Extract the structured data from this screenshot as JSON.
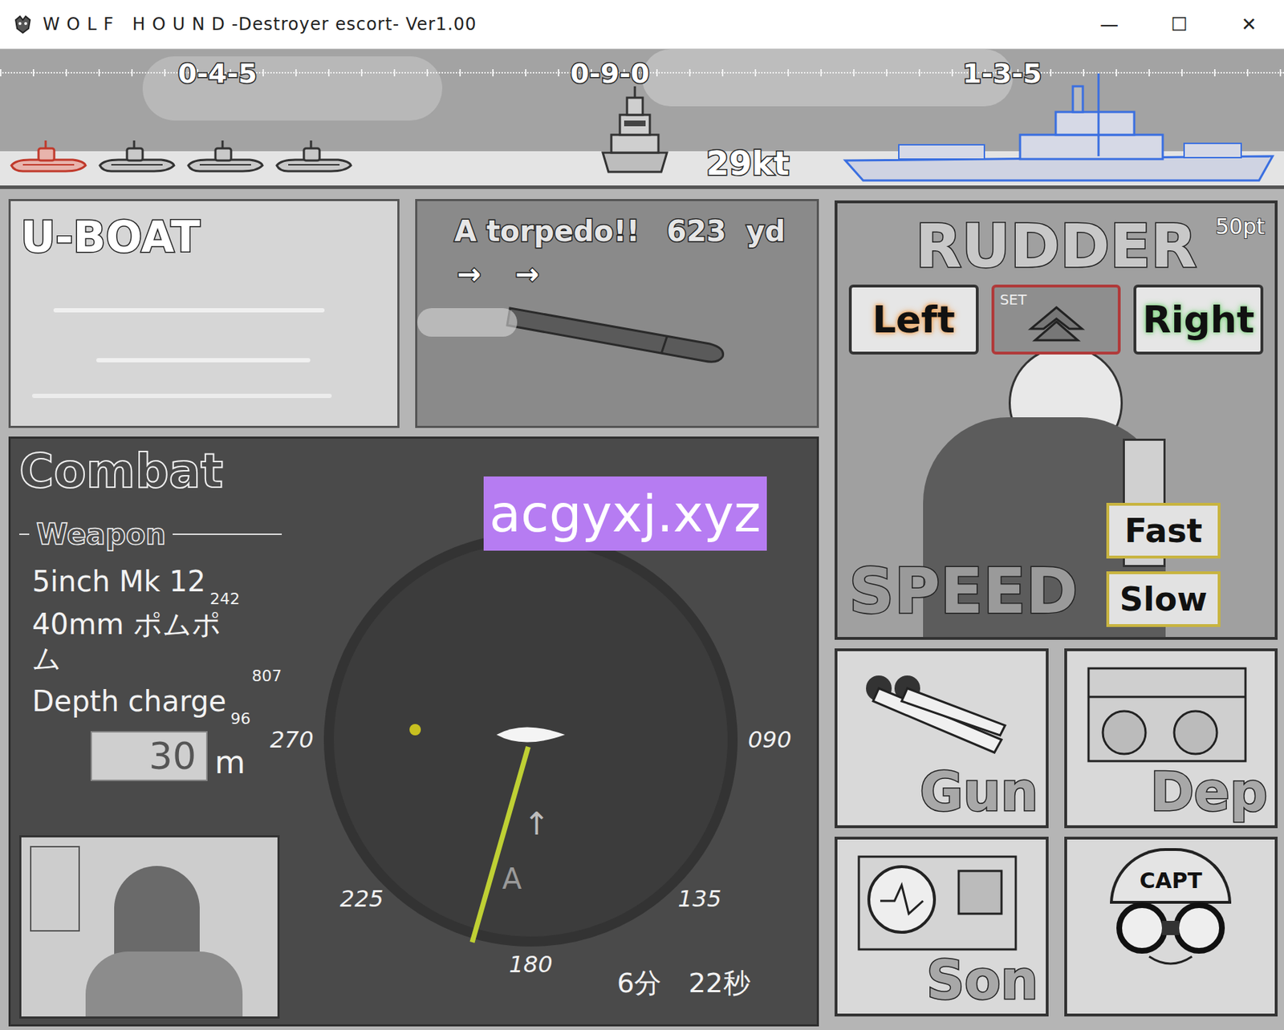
{
  "window": {
    "title": "W O L F   H O U N D -Destroyer escort- Ver1.00",
    "controls": [
      "—",
      "☐",
      "✕"
    ]
  },
  "compass": {
    "marks": [
      "0-4-5",
      "0-9-0",
      "1-3-5"
    ]
  },
  "fleet": {
    "uboats": [
      {
        "hit": true
      },
      {
        "hit": false
      },
      {
        "hit": false
      },
      {
        "hit": false
      }
    ],
    "speed": "29kt",
    "convoy": {
      "highlighted": true
    }
  },
  "uboat_view": {
    "title": "U-BOAT"
  },
  "alert": {
    "text": "A torpedo!!",
    "range": "623",
    "unit": "yd",
    "arrows": [
      "→",
      "→"
    ]
  },
  "combat": {
    "title": "Combat",
    "weapon_header": "Weapon",
    "weapons": [
      {
        "name": "5inch Mk 12",
        "ammo": "242"
      },
      {
        "name": "40mm ポムポム",
        "ammo": "807"
      },
      {
        "name": "Depth charge",
        "ammo": "96"
      }
    ],
    "depth": {
      "value": "30",
      "unit": "m"
    },
    "radar": {
      "labels": [
        "270",
        "090",
        "225",
        "135",
        "180"
      ],
      "sweep_deg": 196,
      "contacts": [
        {
          "bearing": 275,
          "range": 0.56
        }
      ],
      "marker": "A",
      "marker_arrow": "↑"
    },
    "timer": "6分　22秒"
  },
  "watermark": "acgyxj.xyz",
  "rudder": {
    "title": "RUDDER",
    "points": "50pt",
    "options": [
      {
        "label": "Left",
        "selected": false,
        "color": "#f0a050"
      },
      {
        "label": "SET",
        "selected": true,
        "color": "#9a9a9a"
      },
      {
        "label": "Right",
        "selected": false,
        "color": "#7fd67f"
      }
    ],
    "speed_title": "SPEED",
    "speed_buttons": [
      "Fast",
      "Slow"
    ]
  },
  "actions": [
    "Gun",
    "Dep",
    "Son",
    "CAPT"
  ]
}
